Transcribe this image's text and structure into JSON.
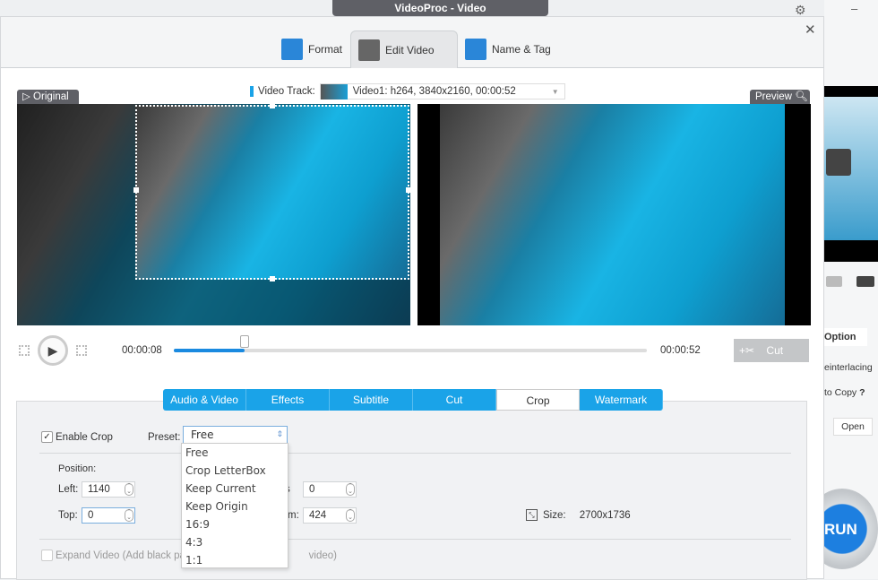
{
  "window": {
    "title": "VideoProc - Video"
  },
  "toolbar": {
    "tabs": [
      {
        "label": "Format"
      },
      {
        "label": "Edit Video"
      },
      {
        "label": "Name & Tag"
      }
    ]
  },
  "preview": {
    "original_label": "Original",
    "preview_label": "Preview",
    "video_track_label": "Video Track:",
    "video_track_value": "Video1: h264, 3840x2160, 00:00:52"
  },
  "player": {
    "current_time": "00:00:08",
    "total_time": "00:00:52",
    "progress_fraction": 0.15,
    "cut_label": "Cut"
  },
  "edit_tabs": [
    {
      "label": "Audio & Video"
    },
    {
      "label": "Effects"
    },
    {
      "label": "Subtitle"
    },
    {
      "label": "Cut"
    },
    {
      "label": "Crop"
    },
    {
      "label": "Watermark"
    }
  ],
  "crop": {
    "enable_label": "Enable Crop",
    "enabled": true,
    "preset_label": "Preset:",
    "preset_value": "Free",
    "preset_options": [
      "Free",
      "Crop LetterBox",
      "Keep Current",
      "Keep Origin",
      "16:9",
      "4:3",
      "1:1"
    ],
    "position_label": "Position:",
    "left_label": "Left:",
    "left_value": "1140",
    "top_label": "Top:",
    "top_value": "0",
    "right_label_partial": "s",
    "right_value": "0",
    "bottom_label_partial": "m:",
    "bottom_value": "424",
    "size_label": "Size:",
    "size_value": "2700x1736",
    "expand_label_a": "Expand Video (Add black pac",
    "expand_label_b": "video)"
  },
  "background_app": {
    "option_label": "Option",
    "deinterlacing_label": "einterlacing",
    "copy_label": "to Copy",
    "help": "?",
    "open_label": "Open",
    "run_label": "RUN"
  }
}
